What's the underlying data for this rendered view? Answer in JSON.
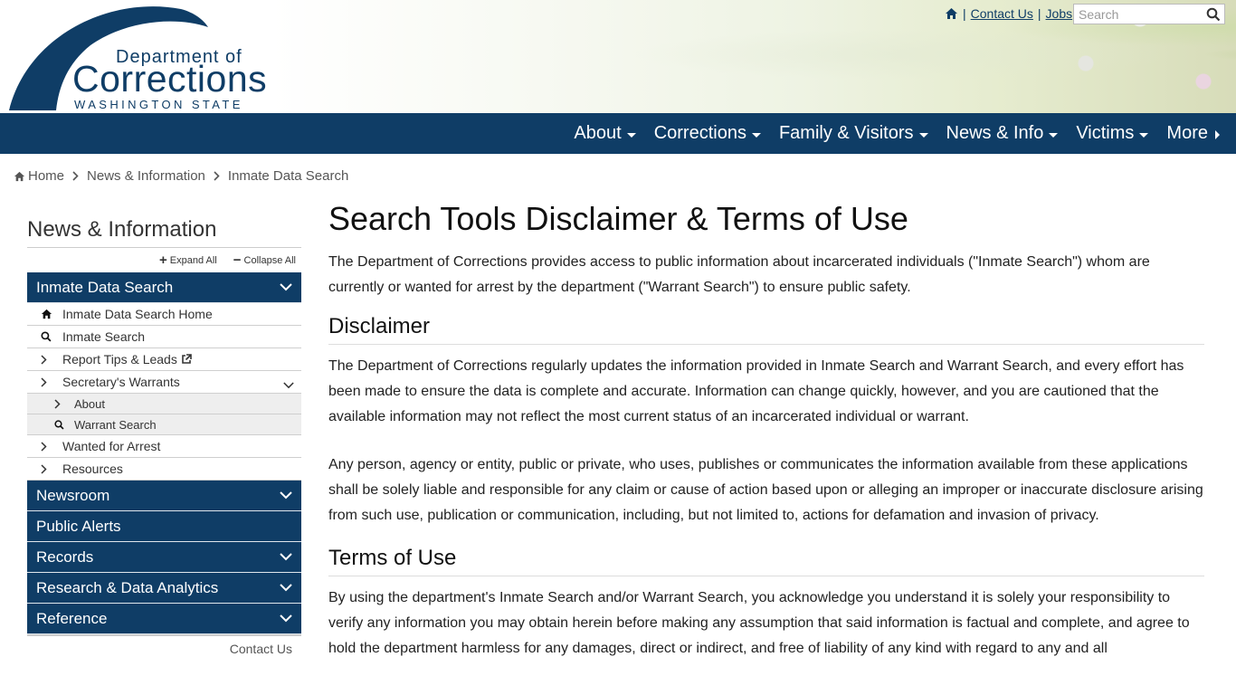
{
  "header": {
    "logo": {
      "line1": "Department of",
      "line2": "Corrections",
      "line3": "WASHINGTON STATE"
    },
    "utility": {
      "home_icon": "home-icon",
      "contact_label": "Contact Us",
      "jobs_label": "Jobs",
      "search_placeholder": "Search",
      "search_icon": "search-icon"
    }
  },
  "nav": {
    "items": [
      {
        "label": "About"
      },
      {
        "label": "Corrections"
      },
      {
        "label": "Family & Visitors"
      },
      {
        "label": "News & Info"
      },
      {
        "label": "Victims"
      },
      {
        "label": "More"
      }
    ]
  },
  "breadcrumb": {
    "items": [
      "Home",
      "News & Information",
      "Inmate Data Search"
    ]
  },
  "sidebar": {
    "title": "News & Information",
    "expand_all": "Expand All",
    "collapse_all": "Collapse All",
    "active_section": "Inmate Data Search",
    "sub_items": {
      "home": "Inmate Data Search Home",
      "inmate_search": "Inmate Search",
      "report_tips": "Report Tips & Leads",
      "warrants": "Secretary's Warrants",
      "warrants_about": "About",
      "warrants_search": "Warrant Search",
      "wanted": "Wanted for Arrest",
      "resources": "Resources"
    },
    "sections": [
      {
        "label": "Newsroom"
      },
      {
        "label": "Public Alerts"
      },
      {
        "label": "Records"
      },
      {
        "label": "Research & Data Analytics"
      },
      {
        "label": "Reference"
      }
    ],
    "contact": "Contact Us"
  },
  "main": {
    "title": "Search Tools Disclaimer & Terms of Use",
    "intro": "The Department of Corrections provides access to public information about incarcerated individuals (\"Inmate Search\") whom are currently or wanted for arrest by the department (\"Warrant Search\") to ensure public safety.",
    "disclaimer_heading": "Disclaimer",
    "disclaimer_p1": "The Department of Corrections regularly updates the information provided in Inmate Search and Warrant Search, and every effort has been made to ensure the data is complete and accurate. Information can change quickly, however, and you are cautioned that the available information may not reflect the most current status of an incarcerated individual or warrant.",
    "disclaimer_p2": "Any person, agency or entity, public or private, who uses, publishes or communicates the information available from these applications shall be solely liable and responsible for any claim or cause of action based upon or alleging an improper or inaccurate disclosure arising from such use, publication or communication, including, but not limited to, actions for defamation and invasion of privacy.",
    "terms_heading": "Terms of Use",
    "terms_p1": "By using the department's Inmate Search and/or Warrant Search, you acknowledge you understand it is solely your responsibility to verify any information you may obtain herein before making any assumption that said information is factual and complete, and agree to hold the department harmless for any damages, direct or indirect, and free of liability of any kind with regard to any and all"
  },
  "colors": {
    "brand_navy": "#0f3d66",
    "sub_item_bg": "#eeeeee"
  }
}
